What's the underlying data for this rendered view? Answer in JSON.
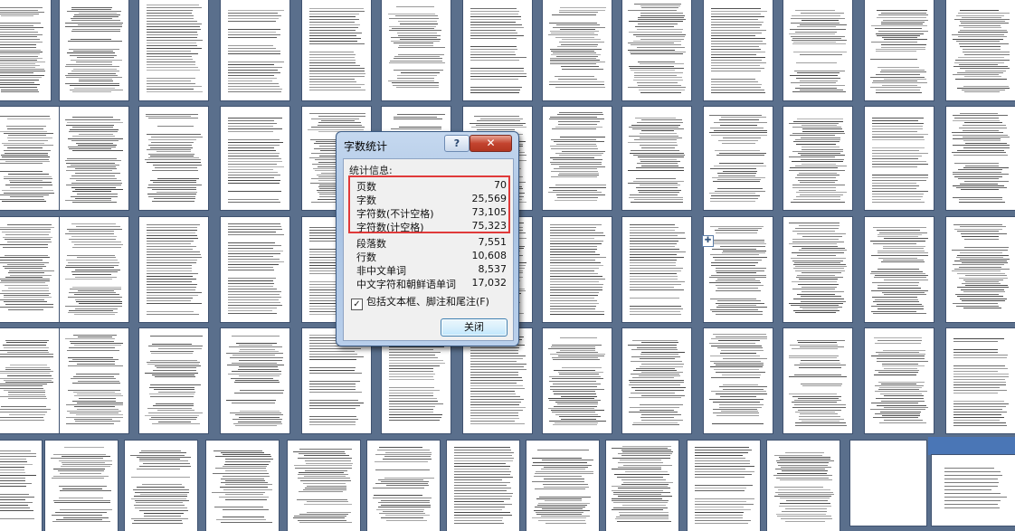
{
  "dialog": {
    "title": "字数统计",
    "help_label": "?",
    "close_label": "✕",
    "stats_label": "统计信息:",
    "stats": [
      {
        "label": "页数",
        "value": "70"
      },
      {
        "label": "字数",
        "value": "25,569"
      },
      {
        "label": "字符数(不计空格)",
        "value": "73,105"
      },
      {
        "label": "字符数(计空格)",
        "value": "75,323"
      },
      {
        "label": "段落数",
        "value": "7,551"
      },
      {
        "label": "行数",
        "value": "10,608"
      },
      {
        "label": "非中文单词",
        "value": "8,537"
      },
      {
        "label": "中文字符和朝鲜语单词",
        "value": "17,032"
      }
    ],
    "include_checkbox": {
      "label": "包括文本框、脚注和尾注(F)",
      "checked": true,
      "mark": "✓"
    },
    "ok_label": "关闭"
  },
  "colors": {
    "background": "#5a6f8c",
    "highlight_border": "#e03a3a",
    "close_button": "#c3442f",
    "corner_accent": "#4a76b6"
  },
  "icons": {
    "move_handle": "move-cross-icon"
  },
  "move_handle_glyph": "✚"
}
